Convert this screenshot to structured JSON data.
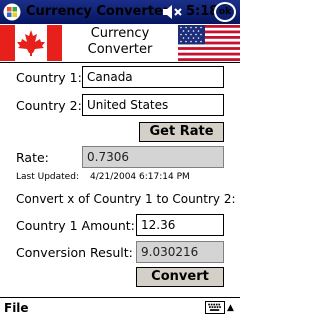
{
  "status_bar": {
    "app_title": "Currency Converter",
    "time": "5:18",
    "ok_label": "ok"
  },
  "header": {
    "line1": "Currency",
    "line2": "Converter"
  },
  "form": {
    "country1_label": "Country 1:",
    "country1_value": "Canada",
    "country2_label": "Country 2:",
    "country2_value": "United States",
    "get_rate_label": "Get Rate",
    "rate_label": "Rate:",
    "rate_value": "0.7306",
    "last_updated_label": "Last Updated:",
    "last_updated_value": "4/21/2004 6:17:14 PM",
    "convert_heading": "Convert x of Country 1 to Country 2:",
    "amount_label": "Country 1 Amount:",
    "amount_value": "12.36",
    "result_label": "Conversion Result:",
    "result_value": "9.030216",
    "convert_label": "Convert"
  },
  "menu": {
    "file_label": "File"
  },
  "colors": {
    "title_bar": "#0b1f6e",
    "button_face": "#d4d0c8",
    "readonly_field": "#d4d4d4"
  },
  "icons": [
    "windows-start-icon",
    "speaker-icon",
    "canada-flag",
    "usa-flag",
    "keyboard-icon",
    "chevron-up-icon"
  ]
}
